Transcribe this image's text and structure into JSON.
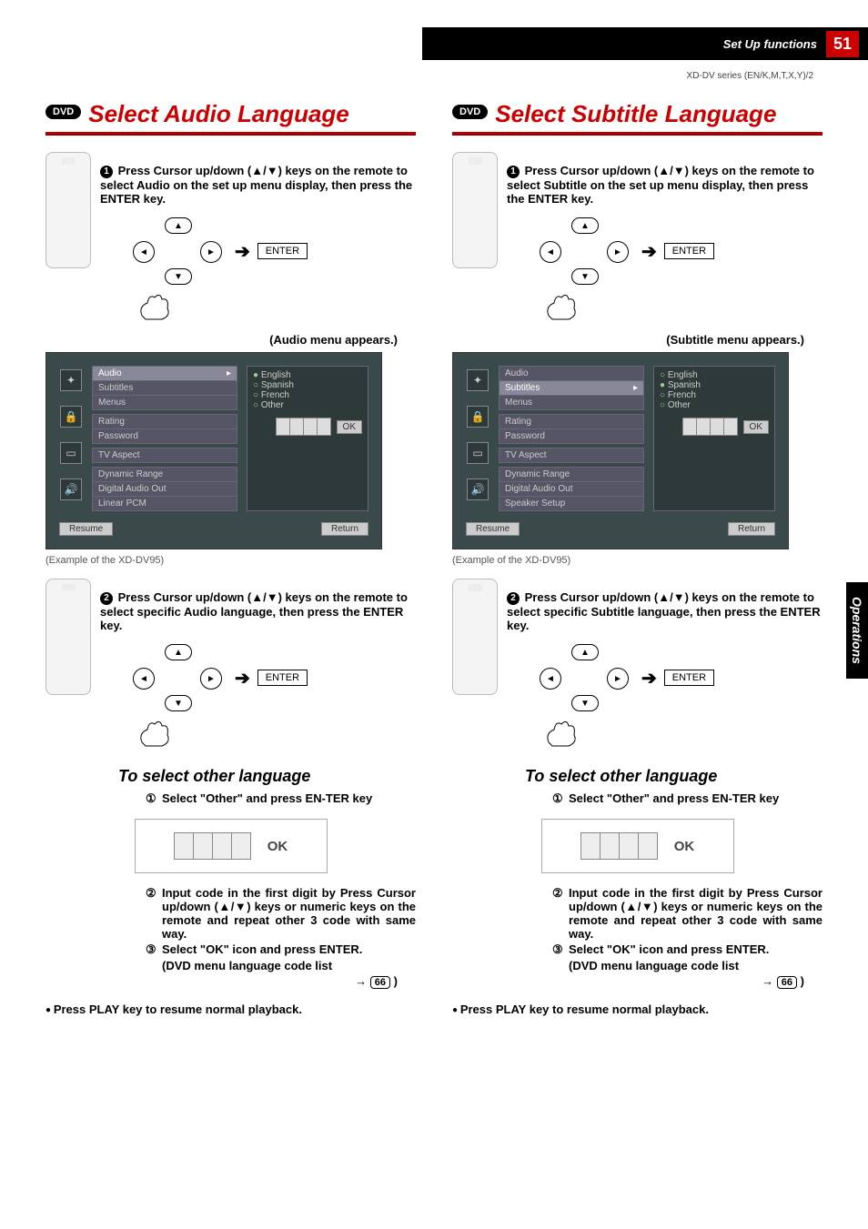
{
  "header": {
    "section": "Set Up functions",
    "page": "51",
    "series": "XD-DV series (EN/K,M,T,X,Y)/2"
  },
  "side_tab": "Operations",
  "left": {
    "badge": "DVD",
    "title": "Select Audio Language",
    "step1": "Press Cursor up/down (▲/▼) keys on the remote to select Audio on the set up menu display, then press the ENTER key.",
    "enter": "ENTER",
    "appears": "(Audio menu appears.)",
    "menu": {
      "items_group1": [
        "Audio",
        "Subtitles",
        "Menus"
      ],
      "selected1": "Audio",
      "items_group2": [
        "Rating",
        "Password"
      ],
      "items_group3": [
        "TV Aspect"
      ],
      "items_group4": [
        "Dynamic Range",
        "Digital Audio Out",
        "Linear PCM"
      ],
      "lang_options": [
        "English",
        "Spanish",
        "French",
        "Other"
      ],
      "lang_selected": "English",
      "ok": "OK",
      "resume": "Resume",
      "return": "Return"
    },
    "example_caption": "(Example of the XD-DV95)",
    "step2": "Press Cursor up/down (▲/▼) keys on the remote to select specific Audio language, then press the ENTER key.",
    "sub_title": "To select other language",
    "other1": "Select \"Other\" and press EN-TER key",
    "ok_label": "OK",
    "other2": "Input code in the first digit by Press Cursor up/down (▲/▼) keys or numeric keys on the remote and repeat other 3 code with same way.",
    "other3": "Select \"OK\" icon and press ENTER.",
    "codelist": "(DVD menu language code list",
    "page_ref": "66",
    "foot": "Press PLAY key to resume normal playback."
  },
  "right": {
    "badge": "DVD",
    "title": "Select Subtitle Language",
    "step1": "Press Cursor up/down (▲/▼) keys on the remote to select Subtitle on the set up menu display, then press the ENTER key.",
    "enter": "ENTER",
    "appears": "(Subtitle menu appears.)",
    "menu": {
      "items_group1": [
        "Audio",
        "Subtitles",
        "Menus"
      ],
      "selected1": "Subtitles",
      "items_group2": [
        "Rating",
        "Password"
      ],
      "items_group3": [
        "TV Aspect"
      ],
      "items_group4": [
        "Dynamic Range",
        "Digital Audio Out",
        "Speaker Setup"
      ],
      "lang_options": [
        "English",
        "Spanish",
        "French",
        "Other"
      ],
      "lang_selected": "Spanish",
      "ok": "OK",
      "resume": "Resume",
      "return": "Return"
    },
    "example_caption": "(Example of the XD-DV95)",
    "step2": "Press Cursor up/down (▲/▼) keys on the remote to select specific Subtitle language, then press the ENTER key.",
    "sub_title": "To select other language",
    "other1": "Select \"Other\" and press EN-TER key",
    "ok_label": "OK",
    "other2": "Input code in the first digit by Press Cursor up/down (▲/▼) keys or numeric keys on the remote and repeat other 3 code with same way.",
    "other3": "Select \"OK\" icon and press ENTER.",
    "codelist": "(DVD menu language code list",
    "page_ref": "66",
    "foot": "Press PLAY key to resume normal playback."
  }
}
